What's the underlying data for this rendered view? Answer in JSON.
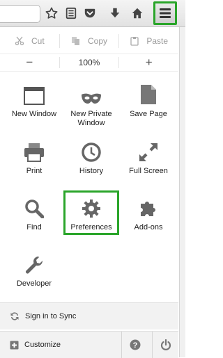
{
  "colors": {
    "highlight": "#2aa52a",
    "icon": "#666666"
  },
  "edit": {
    "cut": "Cut",
    "copy": "Copy",
    "paste": "Paste"
  },
  "zoom": {
    "minus": "−",
    "level": "100%",
    "plus": "+"
  },
  "items": [
    {
      "label": "New Window",
      "icon": "window-icon"
    },
    {
      "label": "New Private Window",
      "icon": "mask-icon"
    },
    {
      "label": "Save Page",
      "icon": "page-icon"
    },
    {
      "label": "Print",
      "icon": "printer-icon"
    },
    {
      "label": "History",
      "icon": "clock-icon"
    },
    {
      "label": "Full Screen",
      "icon": "fullscreen-icon"
    },
    {
      "label": "Find",
      "icon": "magnifier-icon"
    },
    {
      "label": "Preferences",
      "icon": "gear-icon"
    },
    {
      "label": "Add-ons",
      "icon": "puzzle-icon"
    },
    {
      "label": "Developer",
      "icon": "wrench-icon"
    }
  ],
  "footer": {
    "sync": "Sign in to Sync",
    "customize": "Customize"
  }
}
